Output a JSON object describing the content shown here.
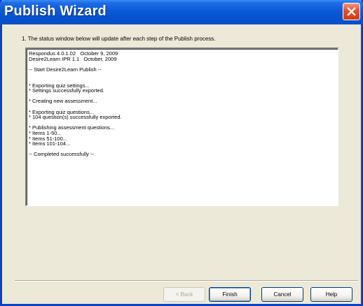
{
  "window": {
    "title": "Publish Wizard",
    "close_icon": "close-icon",
    "accent_color": "#0a5ad6",
    "close_color": "#d23c17"
  },
  "instruction": "1.  The status window below will update after each step of the Publish process.",
  "status_lines": [
    "Respondus 4.0.1.02   October 9, 2009",
    "Desire2Learn IPR 1.1   October, 2009",
    "",
    "-- Start Desire2Learn Publish --",
    "",
    "",
    "* Exporting quiz settings...",
    "* Settings successfully exported.",
    "",
    "* Creating new assessment...",
    "",
    "* Exporting quiz questions...",
    "* 104 question(s) successfully exported.",
    "",
    "* Publishing assessment questions...",
    "* Items 1-50...",
    "* Items 51-100...",
    "* Items 101-104...",
    "",
    "-- Completed successfully --"
  ],
  "buttons": {
    "back": "< Back",
    "finish": "Finish",
    "cancel": "Cancel",
    "help": "Help"
  }
}
